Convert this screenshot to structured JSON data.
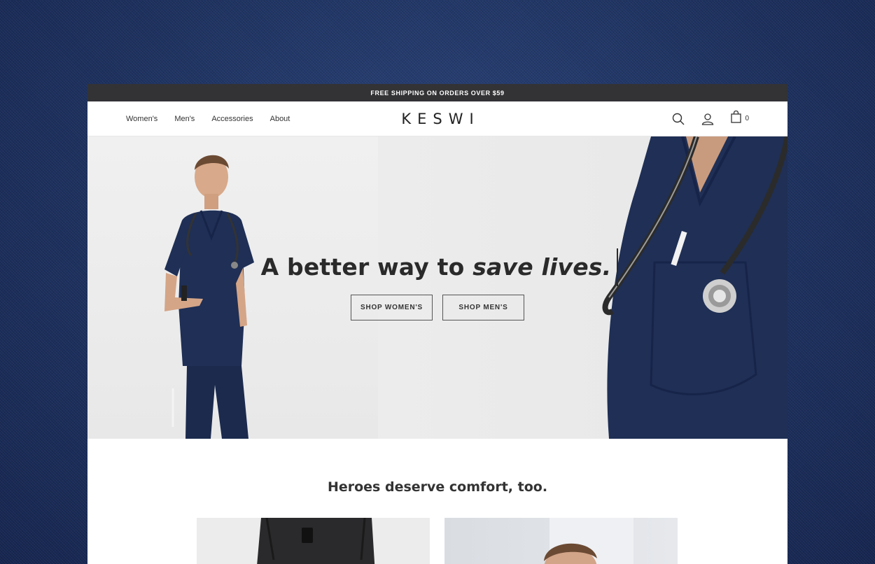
{
  "promo": {
    "text": "FREE SHIPPING ON ORDERS OVER $59"
  },
  "nav": {
    "links": [
      "Women's",
      "Men's",
      "Accessories",
      "About"
    ],
    "logo": "KESWI",
    "cart_count": "0"
  },
  "hero": {
    "headline_plain": "A better way to ",
    "headline_emphasis": "save lives.",
    "cta_women": "SHOP WOMEN'S",
    "cta_men": "SHOP MEN'S"
  },
  "section": {
    "title": "Heroes deserve comfort, too."
  },
  "colors": {
    "navy_scrubs": "#1f2f55",
    "promo_bar": "#333336",
    "background_denim": "#1f3462"
  },
  "icons": [
    "search-icon",
    "account-icon",
    "shopping-bag-icon"
  ]
}
